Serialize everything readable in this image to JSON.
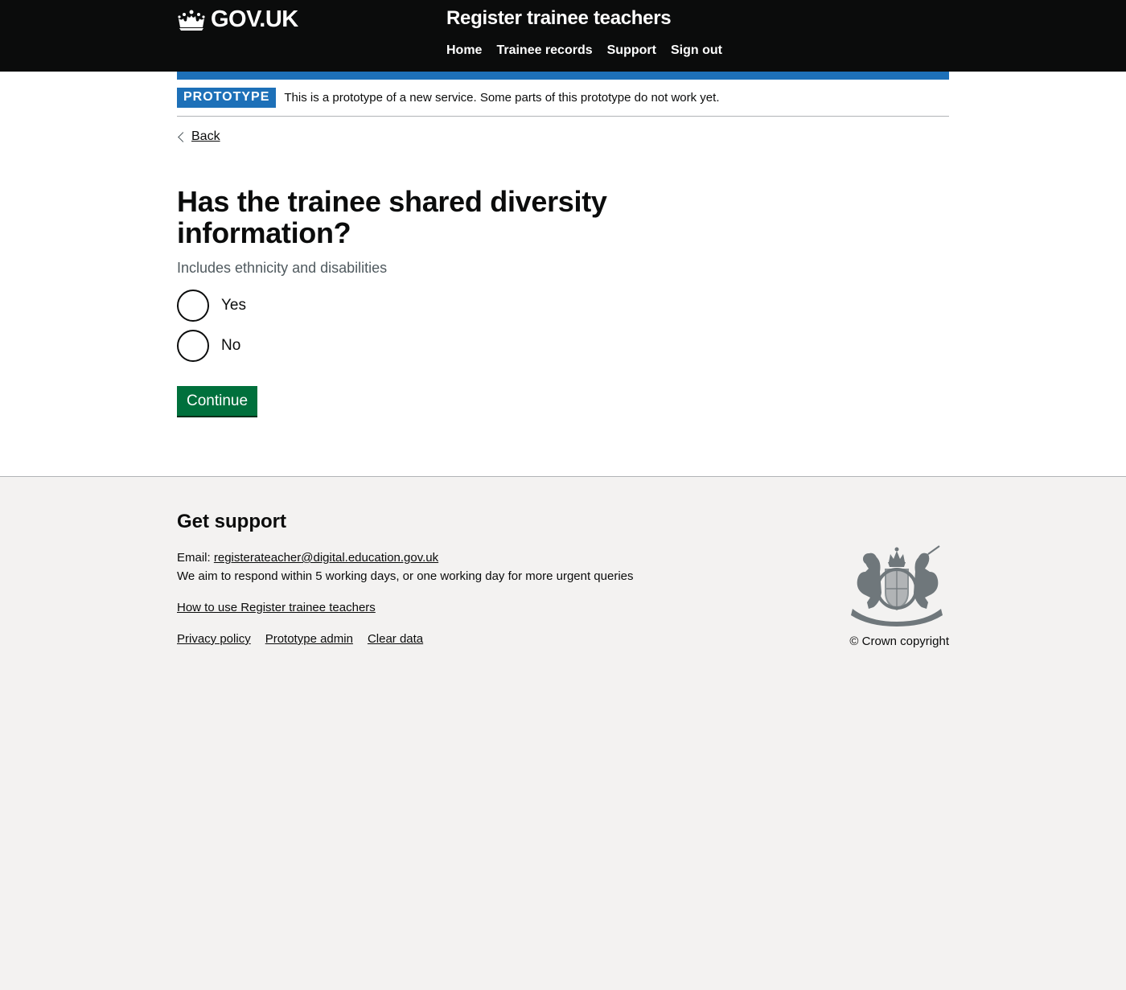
{
  "header": {
    "logo_text": "GOV.UK",
    "service_name": "Register trainee teachers",
    "nav": [
      "Home",
      "Trainee records",
      "Support",
      "Sign out"
    ]
  },
  "phase_banner": {
    "tag": "PROTOTYPE",
    "text": "This is a prototype of a new service. Some parts of this prototype do not work yet."
  },
  "back_link": "Back",
  "question": {
    "heading": "Has the trainee shared diversity information?",
    "hint": "Includes ethnicity and disabilities",
    "options": [
      "Yes",
      "No"
    ]
  },
  "continue_label": "Continue",
  "footer": {
    "heading": "Get support",
    "email_label": "Email:",
    "email": "registerateacher@digital.education.gov.uk",
    "response_text": "We aim to respond within 5 working days, or one working day for more urgent queries",
    "how_to_link": "How to use Register trainee teachers",
    "links": [
      "Privacy policy",
      "Prototype admin",
      "Clear data"
    ],
    "copyright": "© Crown copyright"
  },
  "colors": {
    "header_bg": "#0b0c0c",
    "brand_blue": "#1d70b8",
    "button_green": "#00703c",
    "footer_bg": "#f3f2f1"
  }
}
